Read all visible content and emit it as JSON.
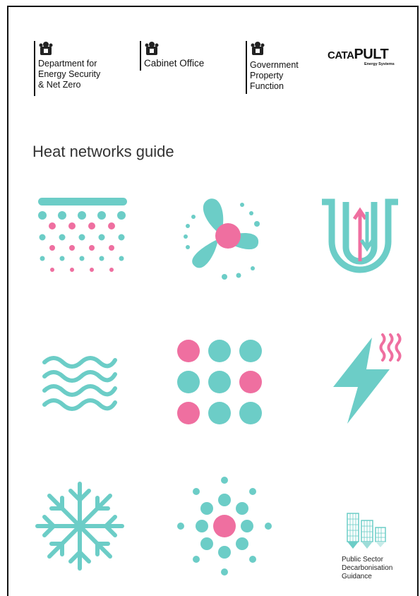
{
  "logos": {
    "desnz": {
      "lines": [
        "Department for",
        "Energy Security",
        "& Net Zero"
      ]
    },
    "cabinet_office": {
      "lines": [
        "Cabinet Office"
      ]
    },
    "gpf": {
      "lines": [
        "Government",
        "Property",
        "Function"
      ]
    },
    "catapult": {
      "word_pre": "CATA",
      "word_main": "PULT",
      "sub": "Energy Systems"
    }
  },
  "title": "Heat networks guide",
  "footer_badge": {
    "lines": [
      "Public Sector",
      "Decarbonisation",
      "Guidance"
    ]
  },
  "colors": {
    "teal": "#6ccdc7",
    "pink": "#ef6fa0",
    "text": "#333333"
  },
  "icons": [
    "sprinkler-icon",
    "fan-icon",
    "u-pipe-flow-icon",
    "waves-icon",
    "dot-grid-icon",
    "electric-heat-icon",
    "snowflake-icon",
    "radial-dots-icon",
    "buildings-icon"
  ]
}
